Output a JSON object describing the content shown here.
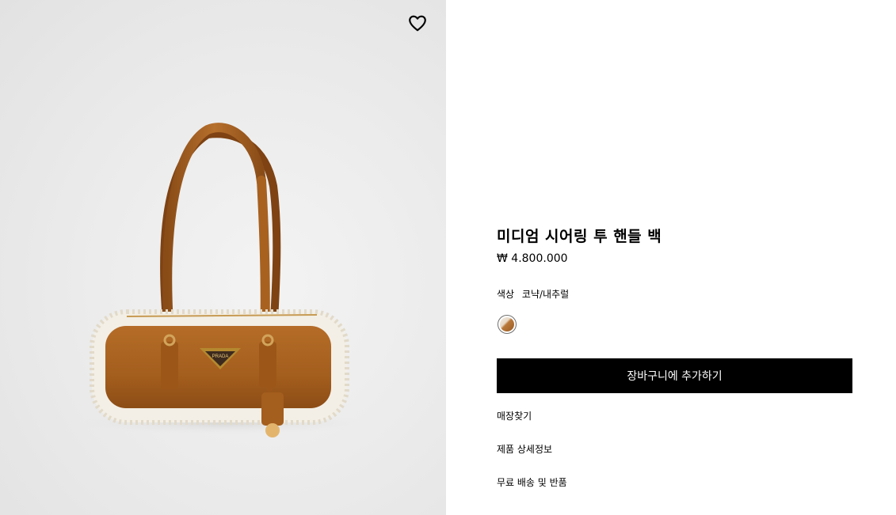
{
  "product": {
    "title": "미디엄 시어링 투 핸들 백",
    "price": "₩ 4.800.000",
    "color_label": "색상",
    "color_value": "코냑/내추럴",
    "add_to_cart": "장바구니에 추가하기",
    "logo_text": "PRADA"
  },
  "links": {
    "find_store": "매장찾기",
    "details": "제품 상세정보",
    "shipping": "무료 배송 및 반품"
  },
  "icons": {
    "wishlist": "heart-icon"
  },
  "colors": {
    "leather": "#a8611f",
    "shearling": "#f3efe6",
    "button": "#000000"
  }
}
